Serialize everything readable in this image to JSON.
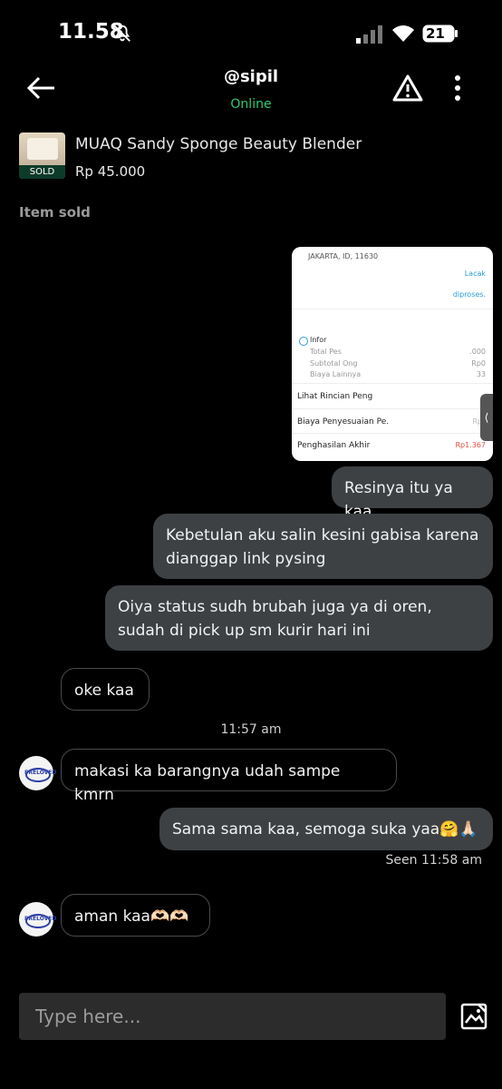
{
  "status_bar": {
    "time": "11.58",
    "battery": "21"
  },
  "header": {
    "title": "@sipil",
    "status": "Online"
  },
  "product": {
    "name": "MUAQ Sandy Sponge Beauty Blender",
    "price": "Rp 45.000",
    "badge": "SOLD"
  },
  "item_sold_label": "Item sold",
  "receipt": {
    "address": "JAKARTA, ID, 11630",
    "lacak": "Lacak",
    "diproses": "diproses.",
    "info": "Infor",
    "line1": "Total Pes",
    "line2": "Subtotal Ong",
    "line3": "Biaya Lainnya",
    "val1": ".000",
    "val2": "Rp0",
    "val3": "33",
    "rincian": "Lihat Rincian Peng",
    "biaya": "Biaya Penyesuaian Pe.",
    "biaya_val": "Rp",
    "penghasilan": "Penghasilan Akhir",
    "penghasilan_val": "Rp1.367"
  },
  "messages": [
    {
      "dir": "out",
      "text": "Resinya itu ya kaa"
    },
    {
      "dir": "out",
      "text": "Kebetulan aku salin kesini gabisa karena dianggap link pysing"
    },
    {
      "dir": "out",
      "text": "Oiya status sudh brubah juga ya di oren, sudah di pick up sm kurir hari ini"
    },
    {
      "dir": "in",
      "text": "oke kaa"
    },
    {
      "dir": "in",
      "text": "makasi ka barangnya udah sampe kmrn"
    },
    {
      "dir": "out",
      "text": "Sama sama kaa, semoga suka yaa🤗🙏🏻"
    },
    {
      "dir": "in",
      "text": "aman kaa🫶🏻🫶🏻"
    }
  ],
  "timestamp": "11:57 am",
  "seen": "Seen 11:58 am",
  "avatar_text": "PRELOVED",
  "input": {
    "placeholder": "Type here..."
  },
  "icons": [
    "back-arrow-icon",
    "warning-icon",
    "more-vert-icon",
    "image-upload-icon",
    "bell-off-icon",
    "signal-icon",
    "wifi-icon",
    "battery-icon"
  ],
  "colors": {
    "background": "#000000",
    "online": "#2ecc71",
    "outgoing_bubble": "#3d4144",
    "input_bg": "#2c2c2c"
  }
}
